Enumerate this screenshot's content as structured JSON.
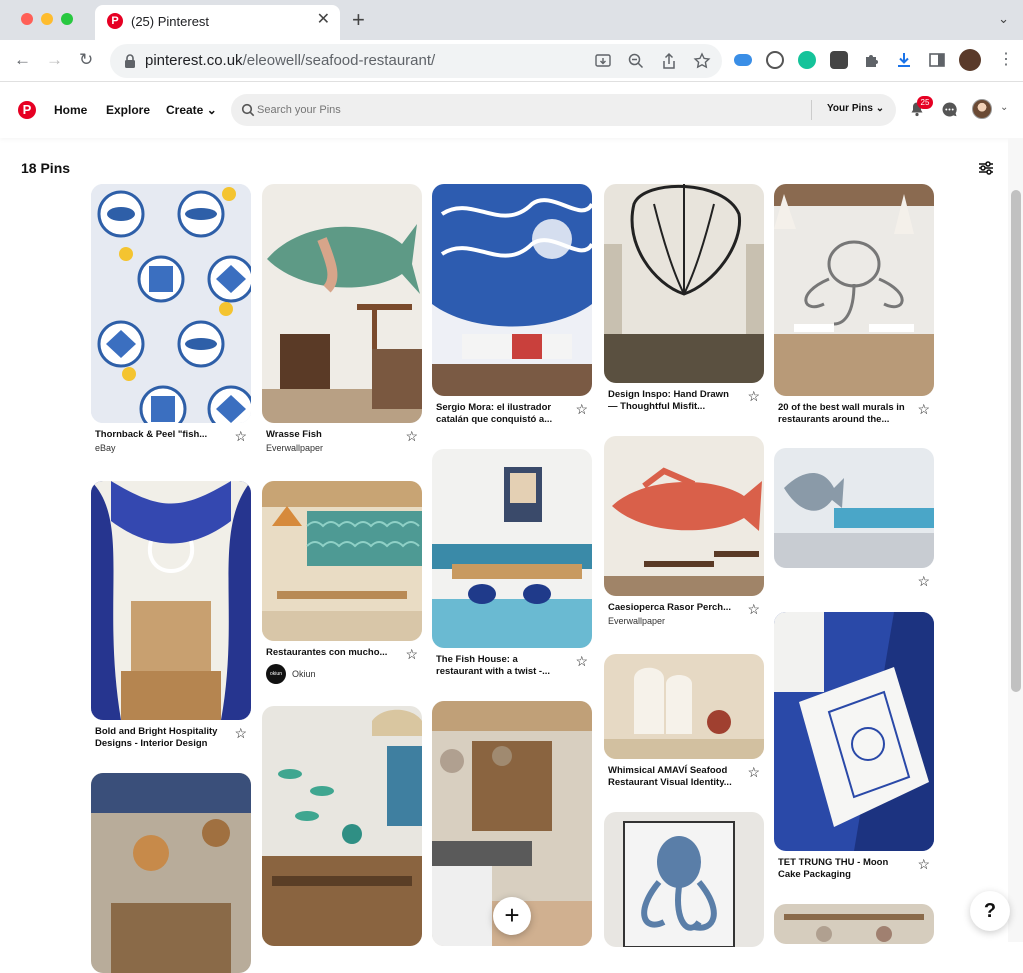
{
  "browser": {
    "tab_title": "(25) Pinterest",
    "url_host": "pinterest.co.uk",
    "url_path": "/eleowell/seafood-restaurant/",
    "tab_close": "✕",
    "new_tab": "+",
    "back": "←",
    "forward": "→",
    "reload": "↻",
    "kebab": "⋮",
    "tab_menu": "⌄"
  },
  "header": {
    "logo": "P",
    "nav": [
      "Home",
      "Explore",
      "Create"
    ],
    "create_chevron": "⌄",
    "search_placeholder": "Search your Pins",
    "your_pins": "Your Pins ⌄",
    "notifications_count": "25",
    "account_chevron": "⌄"
  },
  "board": {
    "pins_count": "18 Pins"
  },
  "pins": [
    {
      "title": "Thornback & Peel \"fish...",
      "source": "eBay"
    },
    {
      "title": "Wrasse Fish",
      "source": "Everwallpaper"
    },
    {
      "title": "Sergio Mora: el ilustrador catalán que conquistó a...",
      "source": ""
    },
    {
      "title": "Design Inspo: Hand Drawn — Thoughtful Misfit...",
      "source": ""
    },
    {
      "title": "20 of the best wall murals in restaurants around the...",
      "source": ""
    },
    {
      "title": "Bold and Bright Hospitality Designs - Interior Design",
      "source": ""
    },
    {
      "title": "Restaurantes con mucho...",
      "source": "Okiun",
      "source_logo": "okiun"
    },
    {
      "title": "The Fish House: a restaurant with a twist -...",
      "source": ""
    },
    {
      "title": "Caesioperca Rasor Perch...",
      "source": "Everwallpaper"
    },
    {
      "title": "",
      "source": ""
    },
    {
      "title": "Whimsical AMAVÍ Seafood Restaurant Visual Identity...",
      "source": ""
    },
    {
      "title": "TET TRUNG THU - Moon Cake Packaging",
      "source": ""
    }
  ],
  "star_glyph": "☆",
  "help_label": "?",
  "add_label": "+"
}
